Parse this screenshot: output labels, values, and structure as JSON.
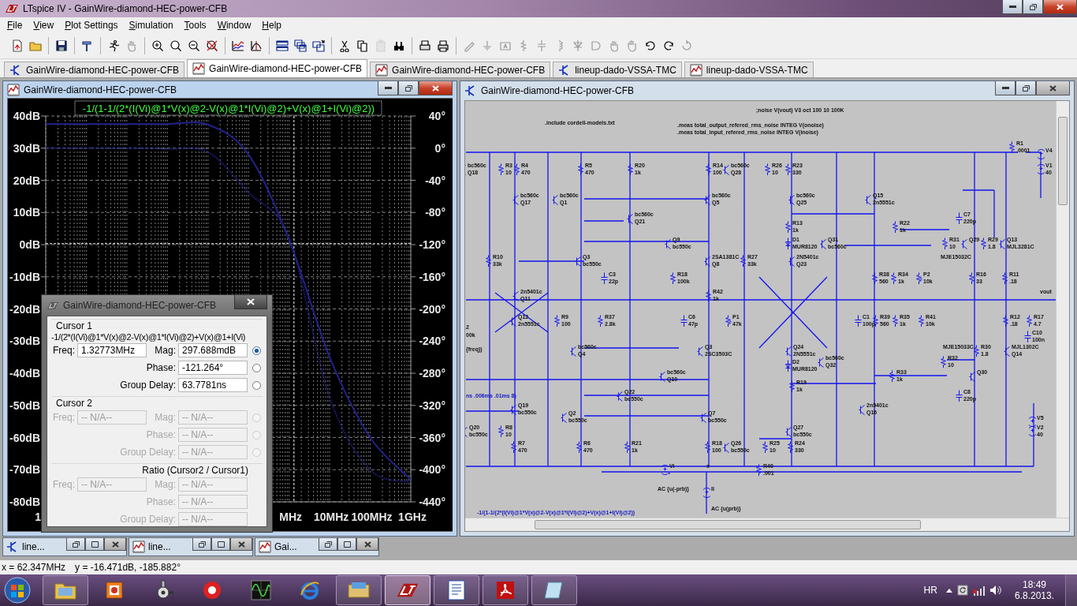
{
  "window": {
    "title": "LTspice IV - GainWire-diamond-HEC-power-CFB",
    "active": true
  },
  "menu": [
    "File",
    "View",
    "Plot Settings",
    "Simulation",
    "Tools",
    "Window",
    "Help"
  ],
  "toolbar": [
    [
      {
        "kind": "new",
        "disabled": false
      },
      {
        "kind": "open",
        "disabled": false
      }
    ],
    [
      {
        "kind": "save",
        "disabled": false
      }
    ],
    [
      {
        "kind": "hammer",
        "disabled": false
      }
    ],
    [
      {
        "kind": "run",
        "disabled": false
      },
      {
        "kind": "halt",
        "disabled": true
      }
    ],
    [
      {
        "kind": "zoomin",
        "disabled": false
      },
      {
        "kind": "zoompan",
        "disabled": false
      },
      {
        "kind": "zoomout",
        "disabled": false
      },
      {
        "kind": "zoomfit",
        "disabled": false
      }
    ],
    [
      {
        "kind": "autorange",
        "disabled": false
      },
      {
        "kind": "cursor",
        "disabled": false
      }
    ],
    [
      {
        "kind": "tileh",
        "disabled": false
      },
      {
        "kind": "cascade",
        "disabled": false
      },
      {
        "kind": "tilev",
        "disabled": false
      }
    ],
    [
      {
        "kind": "cut",
        "disabled": false
      },
      {
        "kind": "copy",
        "disabled": false
      },
      {
        "kind": "paste",
        "disabled": true
      },
      {
        "kind": "find",
        "disabled": false
      }
    ],
    [
      {
        "kind": "printsetup",
        "disabled": false
      },
      {
        "kind": "print",
        "disabled": false
      }
    ],
    [
      {
        "kind": "wire",
        "disabled": true
      },
      {
        "kind": "ground",
        "disabled": true
      },
      {
        "kind": "label",
        "disabled": true
      },
      {
        "kind": "resistor",
        "disabled": true
      },
      {
        "kind": "capacitor",
        "disabled": true
      },
      {
        "kind": "inductor",
        "disabled": true
      },
      {
        "kind": "diode",
        "disabled": true
      },
      {
        "kind": "component",
        "disabled": true
      },
      {
        "kind": "move",
        "disabled": true
      },
      {
        "kind": "drag",
        "disabled": true
      },
      {
        "kind": "undo",
        "disabled": false
      },
      {
        "kind": "redo",
        "disabled": false
      },
      {
        "kind": "rotate",
        "disabled": true
      }
    ]
  ],
  "tabs": [
    {
      "kind": "schematic",
      "label": "GainWire-diamond-HEC-power-CFB",
      "selected": false
    },
    {
      "kind": "plot",
      "label": "GainWire-diamond-HEC-power-CFB",
      "selected": true
    },
    {
      "kind": "plot",
      "label": "GainWire-diamond-HEC-power-CFB",
      "selected": false
    },
    {
      "kind": "schematic",
      "label": "lineup-dado-VSSA-TMC",
      "selected": false
    },
    {
      "kind": "plot",
      "label": "lineup-dado-VSSA-TMC",
      "selected": false
    }
  ],
  "plot_window": {
    "title": "GainWire-diamond-HEC-power-CFB",
    "active": true,
    "chart_data": {
      "type": "line",
      "title": "-1/(1-1/(2*(I(Vi)@1*V(x)@2-V(x)@1*I(Vi)@2)+V(x)@1+I(Vi)@2))",
      "categories": [
        "1",
        null,
        null,
        null,
        null,
        null,
        "MHz",
        "10MHz",
        "100MHz",
        "1GHz"
      ],
      "series": [
        {
          "color": "#22228c",
          "line_style": "solid",
          "values": [
            37.5,
            37.5,
            37.5,
            37.5,
            37.3,
            28,
            1.5,
            -35,
            -60,
            -73
          ]
        },
        {
          "axis": "y2",
          "color": "#22228c",
          "line_style": "dotted",
          "values": [
            0,
            0,
            0,
            -1,
            -5,
            -55,
            -112,
            -310,
            -400,
            -415
          ]
        }
      ],
      "ylim": [
        -80,
        40
      ],
      "y2lim": [
        -440,
        40
      ],
      "grid": true,
      "ref_lines": [
        {
          "axis": "y",
          "value": 0.298
        }
      ],
      "yticks": [
        {
          "value": 40,
          "label": "40dB"
        },
        {
          "value": 30,
          "label": "30dB"
        },
        {
          "value": 20,
          "label": "20dB"
        },
        {
          "value": 10,
          "label": "10dB"
        },
        {
          "value": 0,
          "label": "0dB"
        },
        {
          "value": -10,
          "label": "-10dB"
        },
        {
          "value": -20,
          "label": "-20dB"
        },
        {
          "value": -30,
          "label": "-30dB"
        },
        {
          "value": -40,
          "label": "-40dB"
        },
        {
          "value": -50,
          "label": "-50dB"
        },
        {
          "value": -60,
          "label": "-60dB"
        },
        {
          "value": -70,
          "label": "-70dB"
        },
        {
          "value": -80,
          "label": "-80dB"
        }
      ],
      "y2ticks": [
        {
          "value": 40,
          "label": "40°"
        },
        {
          "value": 0,
          "label": "0°"
        },
        {
          "value": -40,
          "label": "-40°"
        },
        {
          "value": -80,
          "label": "-80°"
        },
        {
          "value": -120,
          "label": "-120°"
        },
        {
          "value": -160,
          "label": "-160°"
        },
        {
          "value": -200,
          "label": "-200°"
        },
        {
          "value": -240,
          "label": "-240°"
        },
        {
          "value": -280,
          "label": "-280°"
        },
        {
          "value": -320,
          "label": "-320°"
        },
        {
          "value": -360,
          "label": "-360°"
        },
        {
          "value": -400,
          "label": "-400°"
        },
        {
          "value": -440,
          "label": "-440°"
        }
      ]
    }
  },
  "cursor_dialog": {
    "title": "GainWire-diamond-HEC-power-CFB",
    "groups": [
      {
        "kind": "cursor",
        "title": "Cursor 1",
        "expression": "-1/(2*(I(Vi)@1*V(x)@2-V(x)@1*I(Vi)@2)+V(x)@1+I(Vi)",
        "disabled": false,
        "fields": [
          {
            "label": "Freq:",
            "value": "1.32773MHz"
          },
          {
            "label": "Mag:",
            "value": "297.688mdB",
            "selected": true
          },
          {
            "label": "Phase:",
            "value": "-121.264°",
            "selected": false
          },
          {
            "label": "Group Delay:",
            "value": "63.7781ns",
            "selected": false
          }
        ]
      },
      {
        "kind": "cursor",
        "title": "Cursor 2",
        "disabled": true,
        "fields": [
          {
            "label": "Freq:",
            "value": "-- N/A--"
          },
          {
            "label": "Mag:",
            "value": "-- N/A--",
            "selected": false
          },
          {
            "label": "Phase:",
            "value": "-- N/A--",
            "selected": false
          },
          {
            "label": "Group Delay:",
            "value": "-- N/A--",
            "selected": false
          }
        ]
      },
      {
        "kind": "ratio",
        "title": "Ratio (Cursor2 / Cursor1)",
        "disabled": true,
        "fields": [
          {
            "label": "Freq:",
            "value": "-- N/A--"
          },
          {
            "label": "Mag:",
            "value": "-- N/A--"
          },
          {
            "label": "Phase:",
            "value": "-- N/A--"
          },
          {
            "label": "Group Delay:",
            "value": "-- N/A--"
          }
        ]
      }
    ]
  },
  "schematic_window": {
    "title": "GainWire-diamond-HEC-power-CFB",
    "active": false,
    "directives": [
      ";noise V(vout) V3 oct 100 10 100K",
      ".include cordell-models.txt",
      ".meas total_output_refered_rms_noise INTEG V(onoise)",
      ".meas total_input_refered_rms_noise INTEG V(inoise)"
    ],
    "expressions": [
      "ns .006ms .01ms 8)",
      "-1/(1-1/(2*(I(Vi)@1*V(x)@2-V(x)@1*I(Vi)@2)+V(x)@1+I(Vi)@2))"
    ],
    "notes": [
      "2",
      "00k",
      "{freq))"
    ],
    "components": [
      {
        "kind": "resistor",
        "lines": [
          "R1",
          ".0001"
        ]
      },
      {
        "kind": "source",
        "lines": [
          "V4"
        ]
      },
      {
        "kind": "transistor",
        "lines": [
          "bc560c",
          "Q18"
        ]
      },
      {
        "kind": "resistor",
        "lines": [
          "R3",
          "10"
        ]
      },
      {
        "kind": "resistor",
        "lines": [
          "R4",
          "470"
        ]
      },
      {
        "kind": "resistor",
        "lines": [
          "R5",
          "470"
        ]
      },
      {
        "kind": "resistor",
        "lines": [
          "R20",
          "1k"
        ]
      },
      {
        "kind": "resistor",
        "lines": [
          "R14",
          "100"
        ]
      },
      {
        "kind": "transistor",
        "lines": [
          "bc560c",
          "Q28"
        ]
      },
      {
        "kind": "resistor",
        "lines": [
          "R26",
          "10"
        ]
      },
      {
        "kind": "resistor",
        "lines": [
          "R23",
          "330"
        ]
      },
      {
        "kind": "source",
        "lines": [
          "V1",
          "40"
        ]
      },
      {
        "kind": "transistor",
        "lines": [
          "bc560c",
          "Q17"
        ]
      },
      {
        "kind": "transistor",
        "lines": [
          "bc560c",
          "Q1"
        ]
      },
      {
        "kind": "transistor",
        "lines": [
          "bc560c",
          "Q5"
        ]
      },
      {
        "kind": "transistor",
        "lines": [
          "bc560c",
          "Q25"
        ]
      },
      {
        "kind": "transistor",
        "lines": [
          "Q15",
          "2n5551c"
        ]
      },
      {
        "kind": "transistor",
        "lines": [
          "bc560c",
          "Q21"
        ]
      },
      {
        "kind": "capacitor",
        "lines": [
          "C7",
          "220p"
        ]
      },
      {
        "kind": "resistor",
        "lines": [
          "R13",
          "1k"
        ]
      },
      {
        "kind": "resistor",
        "lines": [
          "R22",
          "1k"
        ]
      },
      {
        "kind": "transistor",
        "lines": [
          "Q9",
          "bc550c"
        ]
      },
      {
        "kind": "diode",
        "lines": [
          "D1",
          "MUR8120"
        ]
      },
      {
        "kind": "transistor",
        "lines": [
          "Q31",
          "bc560c"
        ]
      },
      {
        "kind": "resistor",
        "lines": [
          "R31",
          "10"
        ]
      },
      {
        "kind": "transistor",
        "lines": [
          "Q29"
        ]
      },
      {
        "kind": "resistor",
        "lines": [
          "R29",
          "1.8"
        ]
      },
      {
        "kind": "transistor",
        "lines": [
          "Q13",
          "MJL3281C"
        ]
      },
      {
        "kind": "resistor",
        "lines": [
          "R10",
          "33k"
        ]
      },
      {
        "kind": "transistor",
        "lines": [
          "Q3",
          "bc550c"
        ]
      },
      {
        "kind": "transistor",
        "lines": [
          "2SA1381C",
          "Q8"
        ]
      },
      {
        "kind": "resistor",
        "lines": [
          "R27",
          "33k"
        ]
      },
      {
        "kind": "transistor",
        "lines": [
          "2N5401c",
          "Q23"
        ]
      },
      {
        "kind": "text",
        "lines": [
          "MJE15032C"
        ]
      },
      {
        "kind": "capacitor",
        "lines": [
          "C3",
          "22p"
        ]
      },
      {
        "kind": "resistor",
        "lines": [
          "R18",
          "100k"
        ]
      },
      {
        "kind": "resistor",
        "lines": [
          "R38",
          "560"
        ]
      },
      {
        "kind": "resistor",
        "lines": [
          "R34",
          "1k"
        ]
      },
      {
        "kind": "pot",
        "lines": [
          "P2",
          "10k"
        ]
      },
      {
        "kind": "resistor",
        "lines": [
          "R16",
          "33"
        ]
      },
      {
        "kind": "resistor",
        "lines": [
          "R11",
          ".18"
        ]
      },
      {
        "kind": "transistor",
        "lines": [
          "2n5401c",
          "Q11"
        ]
      },
      {
        "kind": "resistor",
        "lines": [
          "R42",
          "1k"
        ]
      },
      {
        "kind": "text",
        "lines": [
          "vout"
        ]
      },
      {
        "kind": "transistor",
        "lines": [
          "Q12",
          "2n5551c"
        ]
      },
      {
        "kind": "resistor",
        "lines": [
          "R9",
          "100"
        ]
      },
      {
        "kind": "resistor",
        "lines": [
          "R37",
          "2.8k"
        ]
      },
      {
        "kind": "capacitor",
        "lines": [
          "C6",
          "47p"
        ]
      },
      {
        "kind": "pot",
        "lines": [
          "P1",
          "47k"
        ]
      },
      {
        "kind": "capacitor",
        "lines": [
          "C1",
          "100p"
        ]
      },
      {
        "kind": "resistor",
        "lines": [
          "R39",
          "560"
        ]
      },
      {
        "kind": "resistor",
        "lines": [
          "R35",
          "1k"
        ]
      },
      {
        "kind": "resistor",
        "lines": [
          "R41",
          "10k"
        ]
      },
      {
        "kind": "resistor",
        "lines": [
          "R12",
          ".18"
        ]
      },
      {
        "kind": "resistor",
        "lines": [
          "R17",
          "4.7"
        ]
      },
      {
        "kind": "capacitor",
        "lines": [
          "C10",
          "100n"
        ]
      },
      {
        "kind": "transistor",
        "lines": [
          "bc560c",
          "Q4"
        ]
      },
      {
        "kind": "transistor",
        "lines": [
          "Q3",
          "2SC3503C"
        ]
      },
      {
        "kind": "transistor",
        "lines": [
          "Q24",
          "2N5551c"
        ]
      },
      {
        "kind": "text",
        "lines": [
          "MJE15033C"
        ]
      },
      {
        "kind": "resistor",
        "lines": [
          "R30",
          "1.8"
        ]
      },
      {
        "kind": "transistor",
        "lines": [
          "MJL1302C",
          "Q14"
        ]
      },
      {
        "kind": "diode",
        "lines": [
          "D2",
          "MUR8120"
        ]
      },
      {
        "kind": "transistor",
        "lines": [
          "bc560c",
          "Q32"
        ]
      },
      {
        "kind": "resistor",
        "lines": [
          "R32",
          "10"
        ]
      },
      {
        "kind": "transistor",
        "lines": [
          "bc560c",
          "Q10"
        ]
      },
      {
        "kind": "resistor",
        "lines": [
          "R33",
          "1k"
        ]
      },
      {
        "kind": "transistor",
        "lines": [
          "Q30"
        ]
      },
      {
        "kind": "resistor",
        "lines": [
          "R19",
          "1k"
        ]
      },
      {
        "kind": "transistor",
        "lines": [
          "Q22",
          "bc550c"
        ]
      },
      {
        "kind": "capacitor",
        "lines": [
          "C8",
          "220p"
        ]
      },
      {
        "kind": "transistor",
        "lines": [
          "Q19",
          "bc550c"
        ]
      },
      {
        "kind": "transistor",
        "lines": [
          "2n5401c",
          "Q16"
        ]
      },
      {
        "kind": "transistor",
        "lines": [
          "Q2",
          "bc550c"
        ]
      },
      {
        "kind": "transistor",
        "lines": [
          "Q7",
          "bc550c"
        ]
      },
      {
        "kind": "source",
        "lines": [
          "V5"
        ]
      },
      {
        "kind": "transistor",
        "lines": [
          "Q20",
          "bc550c"
        ]
      },
      {
        "kind": "resistor",
        "lines": [
          "R8",
          "10"
        ]
      },
      {
        "kind": "transistor",
        "lines": [
          "Q27",
          "bc550c"
        ]
      },
      {
        "kind": "source",
        "lines": [
          "V2",
          "40"
        ]
      },
      {
        "kind": "resistor",
        "lines": [
          "R7",
          "470"
        ]
      },
      {
        "kind": "resistor",
        "lines": [
          "R6",
          "470"
        ]
      },
      {
        "kind": "resistor",
        "lines": [
          "R21",
          "1k"
        ]
      },
      {
        "kind": "resistor",
        "lines": [
          "R18",
          "100"
        ]
      },
      {
        "kind": "transistor",
        "lines": [
          "Q26",
          "bc550c"
        ]
      },
      {
        "kind": "resistor",
        "lines": [
          "R25",
          "10"
        ]
      },
      {
        "kind": "resistor",
        "lines": [
          "R24",
          "330"
        ]
      },
      {
        "kind": "source",
        "lines": [
          "Vi"
        ]
      },
      {
        "kind": "text",
        "lines": [
          "x"
        ]
      },
      {
        "kind": "resistor",
        "lines": [
          "R40",
          ".001"
        ]
      },
      {
        "kind": "text",
        "lines": [
          "AC {u(-prb)}"
        ]
      },
      {
        "kind": "source",
        "lines": [
          "II"
        ]
      },
      {
        "kind": "text",
        "lines": [
          "AC {u(prb)}"
        ]
      }
    ]
  },
  "minimized_windows": [
    {
      "kind": "schematic",
      "label": "line..."
    },
    {
      "kind": "plot",
      "label": "line..."
    },
    {
      "kind": "plot",
      "label": "Gai..."
    }
  ],
  "status_bar": {
    "x_readout": "x = 62.347MHz",
    "y_readout": "y = -16.471dB, -185.882°"
  },
  "taskbar": {
    "apps": [
      {
        "kind": "explorer",
        "running": true,
        "active": false
      },
      {
        "kind": "paint",
        "running": false,
        "active": false
      },
      {
        "kind": "valve",
        "running": false,
        "active": false
      },
      {
        "kind": "redcircle",
        "running": false,
        "active": false
      },
      {
        "kind": "scope",
        "running": false,
        "active": false
      },
      {
        "kind": "ie",
        "running": false,
        "active": false
      },
      {
        "kind": "folder",
        "running": true,
        "active": false
      },
      {
        "kind": "ltspice",
        "running": true,
        "active": true
      },
      {
        "kind": "wordpad",
        "running": true,
        "active": false
      },
      {
        "kind": "pdf",
        "running": true,
        "active": false
      },
      {
        "kind": "notes",
        "running": true,
        "active": false
      }
    ],
    "language": "HR",
    "time": "18:49",
    "date": "6.8.2013."
  }
}
